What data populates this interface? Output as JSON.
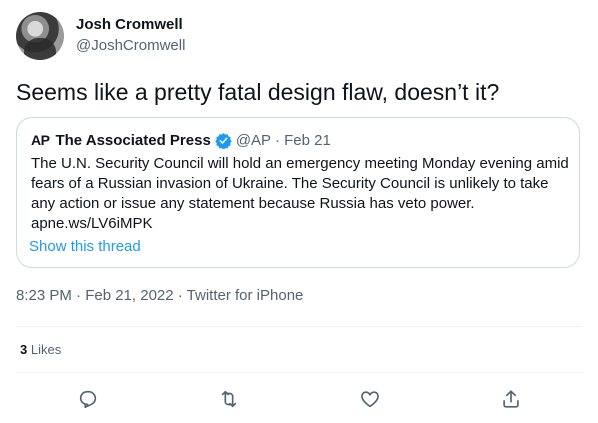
{
  "author": {
    "name": "Josh Cromwell",
    "handle": "@JoshCromwell"
  },
  "tweet": {
    "text": "Seems like a pretty fatal design flaw, doesn’t it?"
  },
  "quoted": {
    "logo_text": "AP",
    "name": "The Associated Press",
    "meta": "@AP · Feb 21",
    "body": "The U.N. Security Council will hold an emergency meeting Monday evening amid fears of a Russian invasion of Ukraine. The Security Council is unlikely to take any action or issue any statement because Russia has veto power. apne.ws/LV6iMPK",
    "show_thread": "Show this thread"
  },
  "meta": {
    "timestamp": "8:23 PM · Feb 21, 2022 · Twitter for iPhone"
  },
  "stats": {
    "likes_count": "3",
    "likes_label": "Likes"
  },
  "actions": [
    "reply-icon",
    "retweet-icon",
    "like-icon",
    "share-icon"
  ],
  "colors": {
    "link": "#1d9bf0",
    "muted": "#536471",
    "border": "#cfd9de"
  }
}
